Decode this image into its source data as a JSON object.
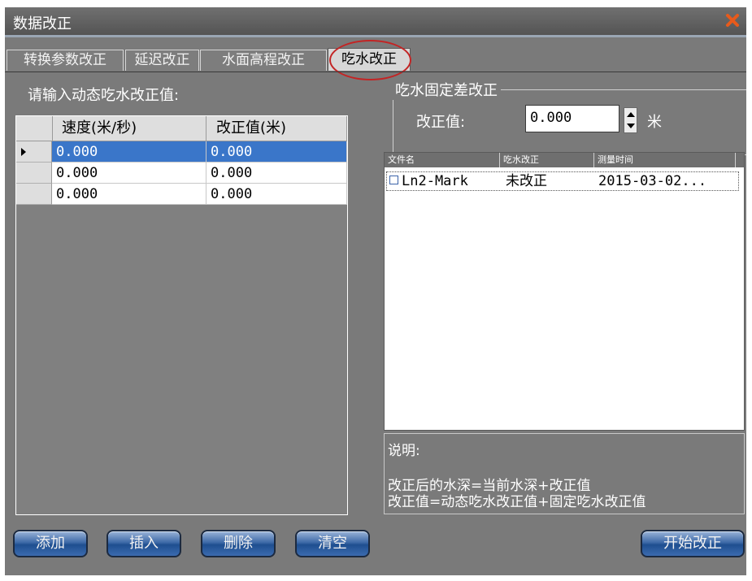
{
  "window": {
    "title": "数据改正",
    "close_icon": "close-icon",
    "accent_close": "#e85a1b"
  },
  "tabs": [
    {
      "label": "转换参数改正"
    },
    {
      "label": "延迟改正"
    },
    {
      "label": "水面高程改正"
    },
    {
      "label": "吃水改正",
      "active": true
    }
  ],
  "left": {
    "prompt": "请输入动态吃水改正值:",
    "columns": [
      "速度(米/秒)",
      "改正值(米)"
    ],
    "rows": [
      {
        "speed": "0.000",
        "value": "0.000",
        "selected": true
      },
      {
        "speed": "0.000",
        "value": "0.000"
      },
      {
        "speed": "0.000",
        "value": "0.000"
      }
    ],
    "buttons": {
      "add": "添加",
      "insert": "插入",
      "delete": "删除",
      "clear": "清空"
    }
  },
  "right": {
    "group_title": "吃水固定差改正",
    "value_label": "改正值:",
    "value": "0.000",
    "unit": "米",
    "file_columns": [
      "文件名",
      "吃水改正",
      "测量时间"
    ],
    "files": [
      {
        "name": "Ln2-Mark",
        "status": "未改正",
        "time": "2015-03-02...",
        "checked": false
      }
    ],
    "note_title": "说明:",
    "note_line1": "改正后的水深=当前水深+改正值",
    "note_line2": "改正值=动态吃水改正值+固定吃水改正值",
    "start_button": "开始改正"
  },
  "colors": {
    "window_bg": "#7a7a7a",
    "selection": "#3a76c9",
    "highlight_ring": "#c32424",
    "button_blue": "#2f5fa0"
  }
}
